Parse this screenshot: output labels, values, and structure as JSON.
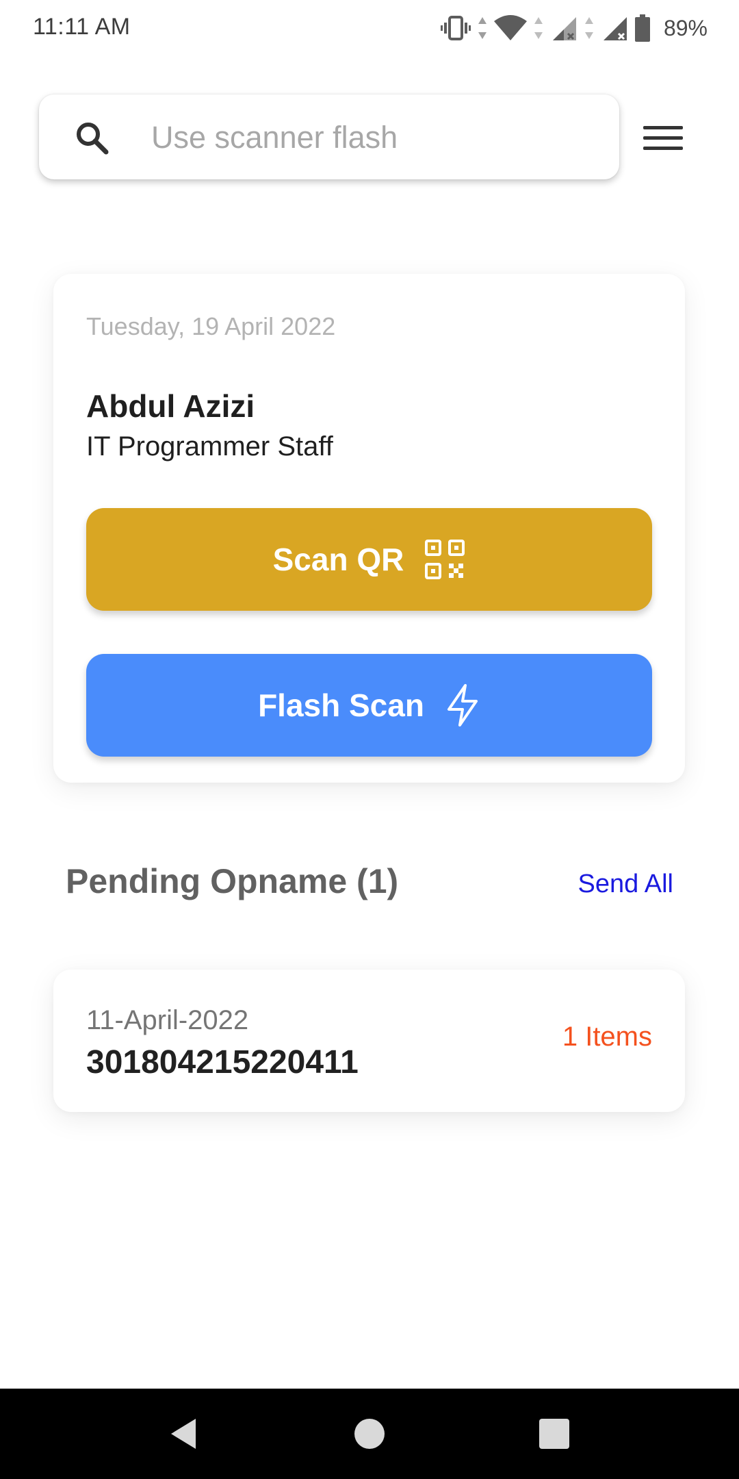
{
  "status_bar": {
    "time": "11:11 AM",
    "battery": "89%",
    "icons": [
      "vibrate-icon",
      "wifi-icon",
      "signal-icon",
      "signal-icon",
      "battery-icon"
    ]
  },
  "search": {
    "placeholder": "Use scanner flash",
    "value": ""
  },
  "card": {
    "date": "Tuesday, 19 April 2022",
    "name": "Abdul Azizi",
    "role": "IT Programmer Staff",
    "scan_qr_label": "Scan QR",
    "flash_scan_label": "Flash Scan"
  },
  "pending": {
    "title": "Pending Opname (1)",
    "send_all_label": "Send All",
    "items": [
      {
        "date": "11-April-2022",
        "code": "301804215220411",
        "count": "1 Items"
      }
    ]
  },
  "colors": {
    "scan_qr_button": "#d9a623",
    "flash_scan_button": "#4a8cfb",
    "send_all_link": "#1a1adf",
    "item_count": "#f4511e"
  }
}
